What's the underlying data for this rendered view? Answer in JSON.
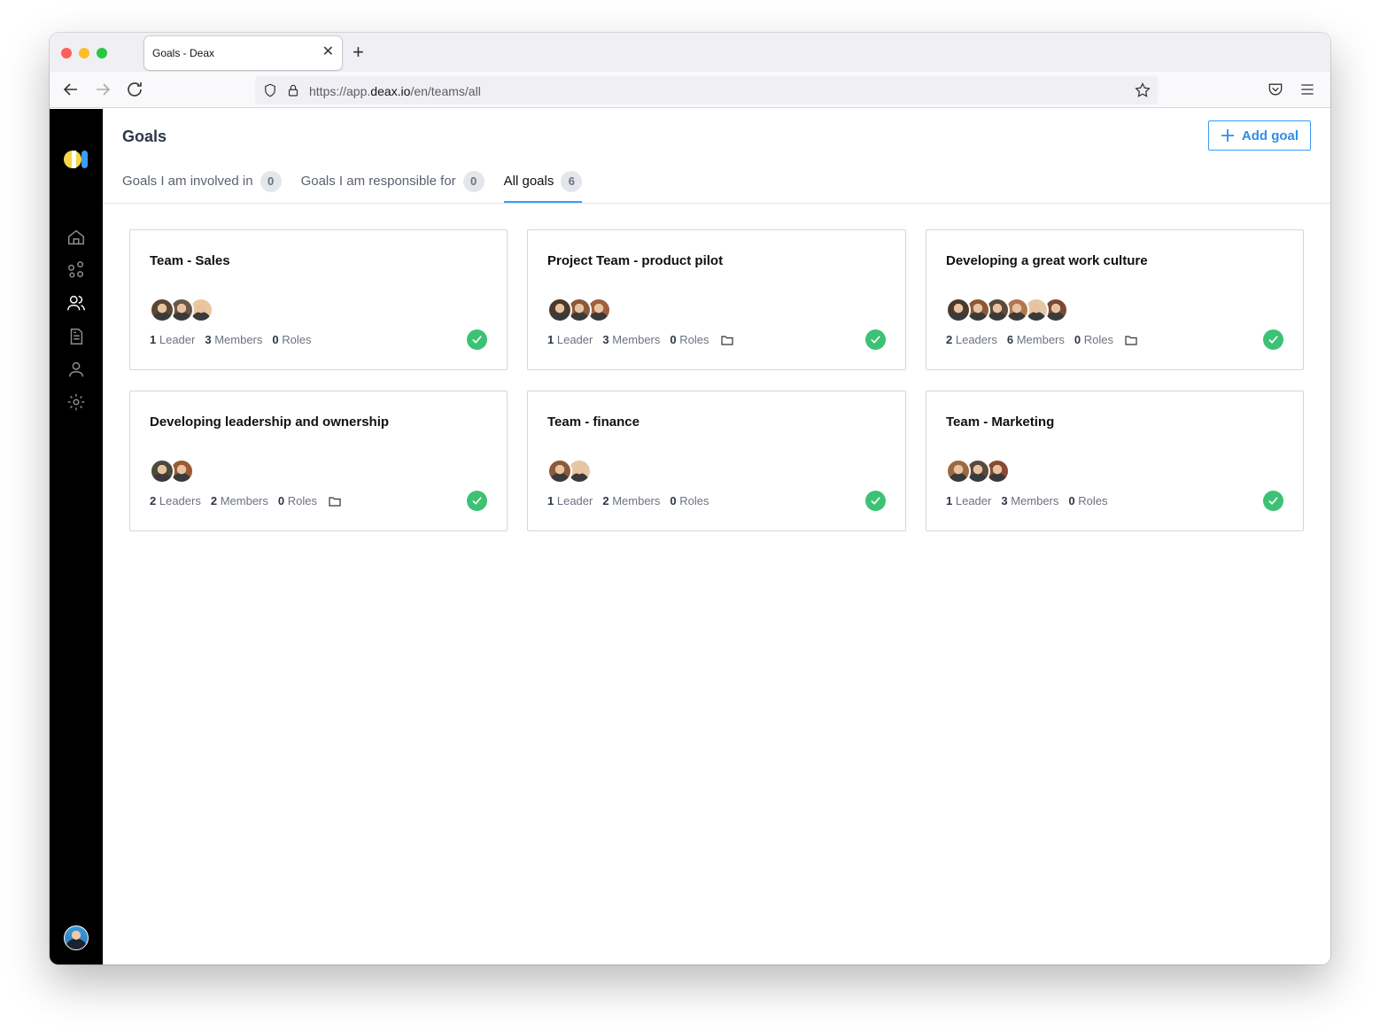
{
  "browser": {
    "tab_title": "Goals - Deax",
    "url_prefix": "https://app.",
    "url_host": "deax.io",
    "url_path": "/en/teams/all"
  },
  "sidebar": {
    "items": [
      {
        "icon": "home-icon"
      },
      {
        "icon": "network-icon"
      },
      {
        "icon": "users-icon"
      },
      {
        "icon": "document-icon"
      },
      {
        "icon": "user-icon"
      },
      {
        "icon": "settings-icon"
      }
    ]
  },
  "header": {
    "title": "Goals",
    "add_button": "Add goal"
  },
  "tabs": [
    {
      "label": "Goals I am involved in",
      "count": "0"
    },
    {
      "label": "Goals I am responsible for",
      "count": "0"
    },
    {
      "label": "All goals",
      "count": "6"
    }
  ],
  "cards": [
    {
      "title": "Team - Sales",
      "leaders": "1",
      "leaders_label": "Leader",
      "members": "3",
      "members_label": "Members",
      "roles": "0",
      "roles_label": "Roles",
      "folder": false,
      "avatars": [
        "#5b4636",
        "#6a5846",
        "#e8c9a0"
      ]
    },
    {
      "title": "Project Team - product pilot",
      "leaders": "1",
      "leaders_label": "Leader",
      "members": "3",
      "members_label": "Members",
      "roles": "0",
      "roles_label": "Roles",
      "folder": true,
      "avatars": [
        "#4a3a2e",
        "#8a5a38",
        "#a06040"
      ]
    },
    {
      "title": "Developing a great work culture",
      "leaders": "2",
      "leaders_label": "Leaders",
      "members": "6",
      "members_label": "Members",
      "roles": "0",
      "roles_label": "Roles",
      "folder": true,
      "avatars": [
        "#4a3a2e",
        "#8a5a38",
        "#5b4a3a",
        "#b0784f",
        "#e3c8a8",
        "#7a4a32"
      ]
    },
    {
      "title": "Developing leadership and ownership",
      "leaders": "2",
      "leaders_label": "Leaders",
      "members": "2",
      "members_label": "Members",
      "roles": "0",
      "roles_label": "Roles",
      "folder": true,
      "avatars": [
        "#4a4a3e",
        "#9a5a3a"
      ]
    },
    {
      "title": "Team - finance",
      "leaders": "1",
      "leaders_label": "Leader",
      "members": "2",
      "members_label": "Members",
      "roles": "0",
      "roles_label": "Roles",
      "folder": false,
      "avatars": [
        "#8a5a3a",
        "#e3c8a8"
      ]
    },
    {
      "title": "Team - Marketing",
      "leaders": "1",
      "leaders_label": "Leader",
      "members": "3",
      "members_label": "Members",
      "roles": "0",
      "roles_label": "Roles",
      "folder": false,
      "avatars": [
        "#9a6a40",
        "#5a4a3e",
        "#8a4a32"
      ]
    }
  ],
  "colors": {
    "accent": "#3b9cf5",
    "success": "#3cc274",
    "sidebar": "#000000"
  }
}
